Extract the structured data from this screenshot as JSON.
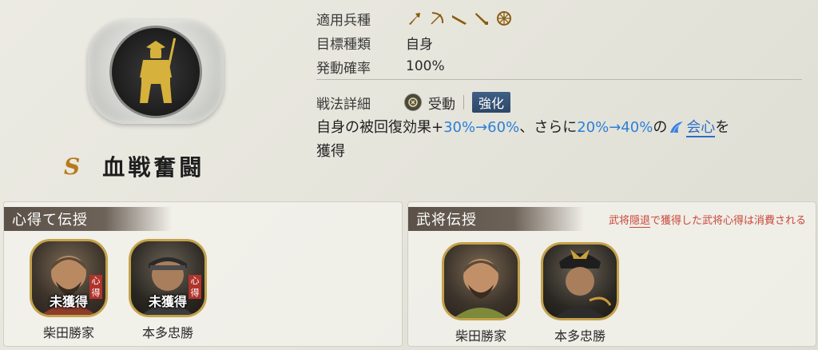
{
  "skill": {
    "grade": "S",
    "name": "血戦奮闘"
  },
  "info": {
    "troop_label": "適用兵種",
    "troop_icons": [
      "spear-icon",
      "bow-icon",
      "gun-icon",
      "sword-icon",
      "horse-wheel-icon"
    ],
    "target_label": "目標種類",
    "target_value": "自身",
    "rate_label": "発動確率",
    "rate_value": "100%"
  },
  "detail": {
    "label": "戦法詳細",
    "type": "受動",
    "type_icon": "passive-icon",
    "enhance": "強化",
    "desc_1": "自身の被回復効果+",
    "desc_2": "30%→60%",
    "desc_3": "、さらに",
    "desc_4": "20%→40%",
    "desc_5": "の",
    "desc_6": "会心",
    "desc_7": "を",
    "desc_8": "獲得",
    "colors": {
      "highlight": "#2c7fd8",
      "accent": "#b77a1e"
    }
  },
  "left_panel": {
    "title": "心得て伝授",
    "cards": [
      {
        "status": "未獲得",
        "name": "柴田勝家",
        "seal": "心得"
      },
      {
        "status": "未獲得",
        "name": "本多忠勝",
        "seal": "心得"
      }
    ]
  },
  "right_panel": {
    "title": "武将伝授",
    "note_1": "武将",
    "note_2": "隠退",
    "note_3": "で獲得した武将心得は消費される",
    "cards": [
      {
        "name": "柴田勝家"
      },
      {
        "name": "本多忠勝"
      }
    ]
  }
}
